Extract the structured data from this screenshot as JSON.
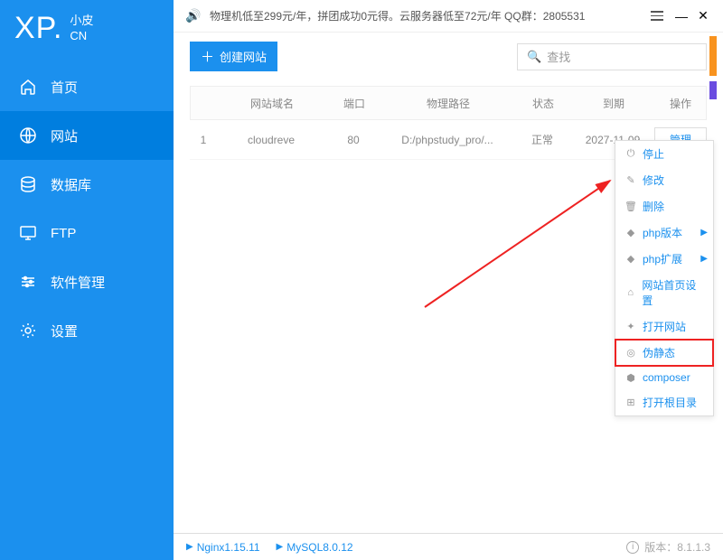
{
  "logo": {
    "main": "XP.",
    "sub1": "小皮",
    "sub2": "CN"
  },
  "announcement": "物理机低至299元/年，拼团成功0元得。云服务器低至72元/年  QQ群：2805531",
  "sidebar": {
    "items": [
      {
        "label": "首页"
      },
      {
        "label": "网站"
      },
      {
        "label": "数据库"
      },
      {
        "label": "FTP"
      },
      {
        "label": "软件管理"
      },
      {
        "label": "设置"
      }
    ]
  },
  "toolbar": {
    "create_label": "创建网站"
  },
  "search": {
    "placeholder": "查找"
  },
  "table": {
    "headers": {
      "domain": "网站域名",
      "port": "端口",
      "path": "物理路径",
      "status": "状态",
      "expiry": "到期",
      "op": "操作"
    },
    "rows": [
      {
        "idx": "1",
        "domain": "cloudreve",
        "port": "80",
        "path": "D:/phpstudy_pro/...",
        "status": "正常",
        "expiry": "2027-11-09",
        "op": "管理"
      }
    ]
  },
  "menu": {
    "items": [
      {
        "label": "停止",
        "icon": "⏻"
      },
      {
        "label": "修改",
        "icon": "✎"
      },
      {
        "label": "删除",
        "icon": "🗑"
      },
      {
        "label": "php版本",
        "icon": "◆",
        "sub": true
      },
      {
        "label": "php扩展",
        "icon": "◆",
        "sub": true
      },
      {
        "label": "网站首页设置",
        "icon": "⌂"
      },
      {
        "label": "打开网站",
        "icon": "✦"
      },
      {
        "label": "伪静态",
        "icon": "◎",
        "hl": true
      },
      {
        "label": "composer",
        "icon": "⬢"
      },
      {
        "label": "打开根目录",
        "icon": "⊞"
      }
    ]
  },
  "statusbar": {
    "nginx": "Nginx1.15.11",
    "mysql": "MySQL8.0.12",
    "version_label": "版本：",
    "version": "8.1.1.3"
  }
}
